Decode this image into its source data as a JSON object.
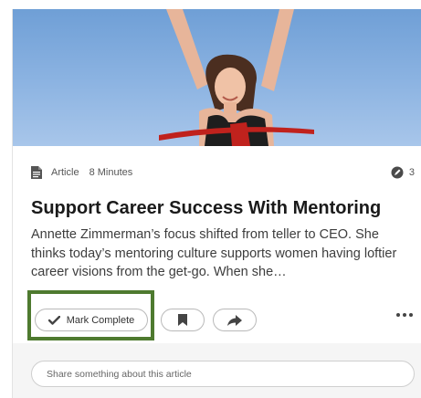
{
  "article": {
    "type": "Article",
    "duration": "8 Minutes",
    "comment_count": "3",
    "title": "Support Career Success With Mentoring",
    "description": "Annette Zimmerman’s focus shifted from teller to CEO. She thinks today’s mentoring culture supports women having loftier career visions from the get-go. When she…"
  },
  "actions": {
    "mark_complete_label": "Mark Complete",
    "bookmark_icon": "bookmark-icon",
    "share_icon": "share-arrow-icon",
    "more_icon": "more-dots-icon"
  },
  "share": {
    "placeholder": "Share something about this article"
  },
  "colors": {
    "highlight_border": "#4e7a2f",
    "footer_bg": "#f5f5f5",
    "sky": "#8db4e2"
  }
}
